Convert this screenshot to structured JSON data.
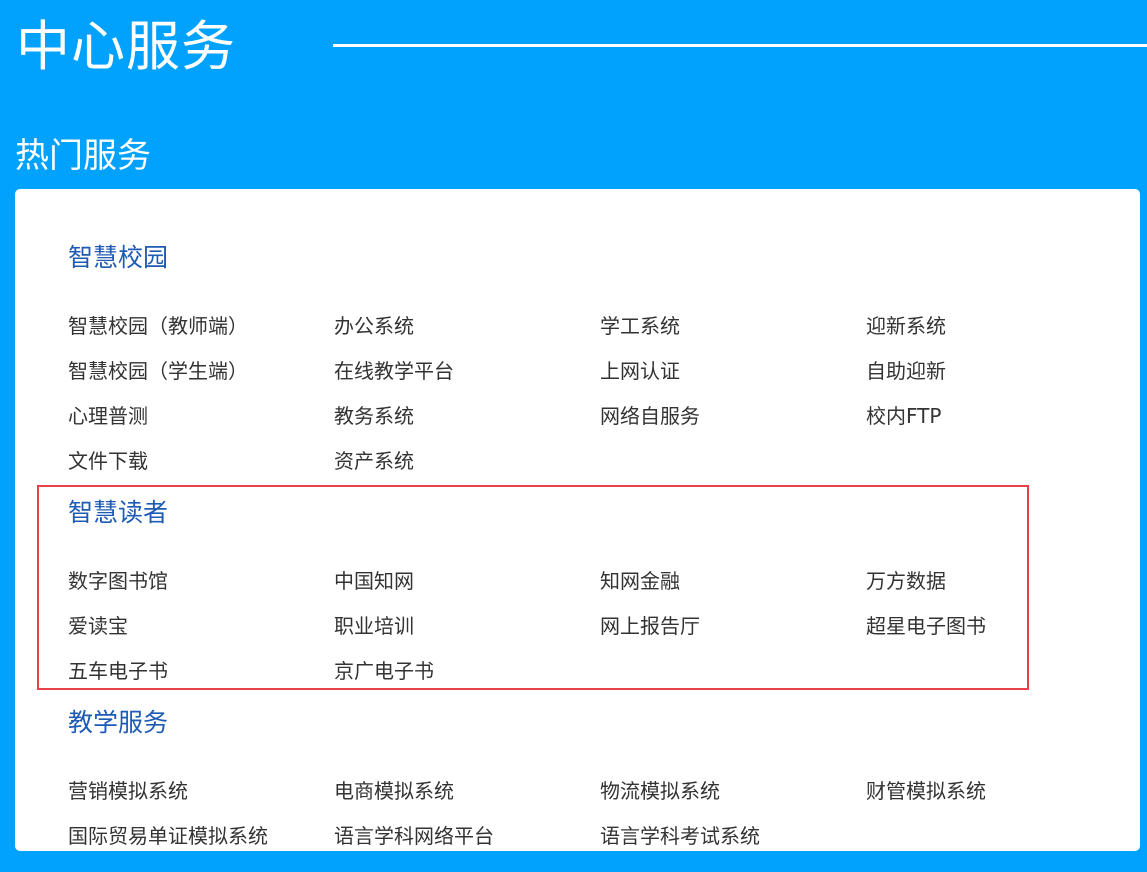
{
  "header": {
    "title": "中心服务"
  },
  "section": {
    "heading": "热门服务"
  },
  "groups": [
    {
      "title": "智慧校园",
      "items": [
        "智慧校园（教师端）",
        "办公系统",
        "学工系统",
        "迎新系统",
        "智慧校园（学生端）",
        "在线教学平台",
        "上网认证",
        "自助迎新",
        "心理普测",
        "教务系统",
        "网络自服务",
        "校内FTP",
        "文件下载",
        "资产系统"
      ]
    },
    {
      "title": "智慧读者",
      "items": [
        "数字图书馆",
        "中国知网",
        "知网金融",
        "万方数据",
        "爱读宝",
        "职业培训",
        "网上报告厅",
        "超星电子图书",
        "五车电子书",
        "京广电子书"
      ]
    },
    {
      "title": "教学服务",
      "items": [
        "营销模拟系统",
        "电商模拟系统",
        "物流模拟系统",
        "财管模拟系统",
        "国际贸易单证模拟系统",
        "语言学科网络平台",
        "语言学科考试系统"
      ]
    }
  ],
  "colors": {
    "background": "#00a2fe",
    "group_title": "#1e5bb5",
    "item_text": "#333333",
    "highlight_border": "#e8414a"
  }
}
